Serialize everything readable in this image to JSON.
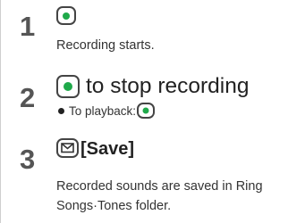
{
  "steps": [
    {
      "number": "1",
      "key_icon": "green-dot-key-icon",
      "text": "Recording starts."
    },
    {
      "number": "2",
      "key_icon": "green-dot-key-icon",
      "action_text": "to stop recording",
      "note_label": "To playback:",
      "note_key_icon": "green-dot-key-icon"
    },
    {
      "number": "3",
      "key_icon": "mail-key-icon",
      "action_label": "[Save]",
      "text_line1": "Recorded sounds are saved in Ring",
      "text_line2": "Songs·Tones folder."
    }
  ],
  "colors": {
    "key_dot": "#1fa94a",
    "step_number": "#555555",
    "key_border": "#444444"
  }
}
